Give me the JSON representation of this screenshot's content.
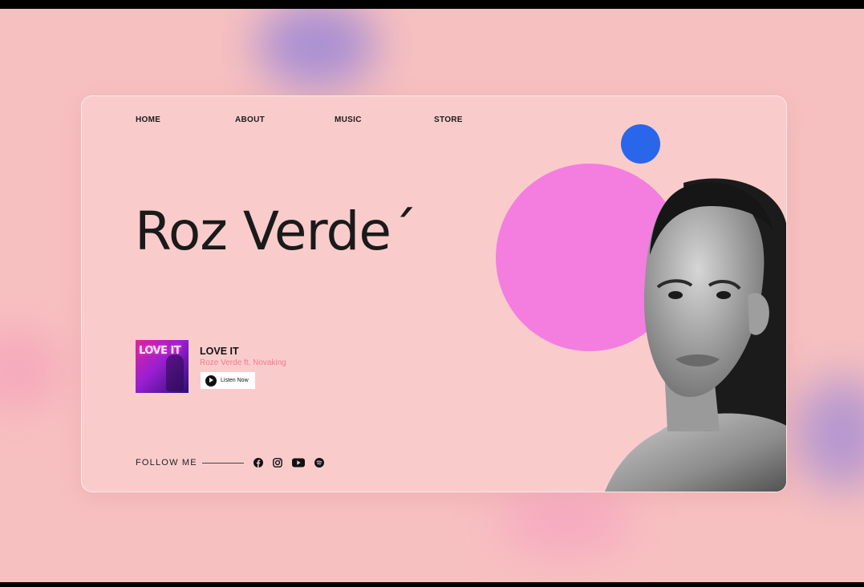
{
  "nav": {
    "items": [
      {
        "label": "HOME"
      },
      {
        "label": "ABOUT"
      },
      {
        "label": "MUSIC"
      },
      {
        "label": "STORE"
      }
    ]
  },
  "hero": {
    "name": "Roz Verde´"
  },
  "release": {
    "cover_text": "LOVE IT",
    "title": "LOVE IT",
    "artist": "Roze Verde ft. Novaking",
    "button_label": "Listen Now"
  },
  "follow": {
    "label": "FOLLOW ME",
    "socials": [
      "facebook-icon",
      "instagram-icon",
      "youtube-icon",
      "spotify-icon"
    ]
  },
  "colors": {
    "background": "#f7c0c0",
    "card": "#f9cccb",
    "accent_blue": "#2a66ea",
    "accent_pink": "#f37ee0",
    "artist_text": "#ef7d8f"
  }
}
